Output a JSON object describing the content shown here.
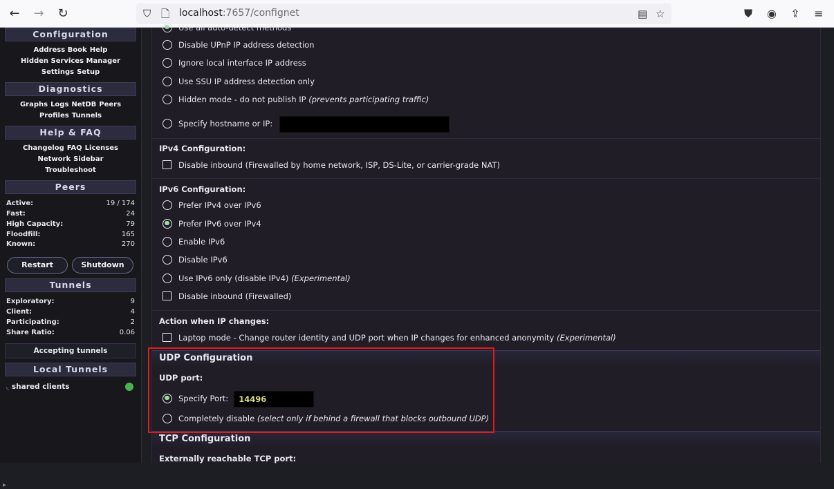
{
  "browser": {
    "url_host": "localhost",
    "url_path": ":7657/confignet",
    "icons": [
      "back-icon",
      "forward-icon",
      "reload-icon",
      "shield-icon",
      "page-icon",
      "reader-icon",
      "bookmark-star-icon",
      "pocket-icon",
      "account-icon",
      "extensions-icon",
      "menu-icon"
    ]
  },
  "sidebar": {
    "configuration": {
      "title": "Configuration",
      "links": [
        "Address Book",
        "Help",
        "Hidden Services Manager",
        "Settings",
        "Setup"
      ]
    },
    "diagnostics": {
      "title": "Diagnostics",
      "links": [
        "Graphs",
        "Logs",
        "NetDB",
        "Peers",
        "Profiles",
        "Tunnels"
      ]
    },
    "help": {
      "title": "Help & FAQ",
      "links": [
        "Changelog",
        "FAQ",
        "Licenses",
        "Network",
        "Sidebar",
        "Troubleshoot"
      ]
    },
    "peers": {
      "title": "Peers",
      "stats": [
        {
          "label": "Active:",
          "value": "19 / 174"
        },
        {
          "label": "Fast:",
          "value": "24"
        },
        {
          "label": "High Capacity:",
          "value": "79"
        },
        {
          "label": "Floodfill:",
          "value": "165"
        },
        {
          "label": "Known:",
          "value": "270"
        }
      ]
    },
    "restart_label": "Restart",
    "shutdown_label": "Shutdown",
    "tunnels": {
      "title": "Tunnels",
      "stats": [
        {
          "label": "Exploratory:",
          "value": "9"
        },
        {
          "label": "Client:",
          "value": "4"
        },
        {
          "label": "Participating:",
          "value": "2"
        },
        {
          "label": "Share Ratio:",
          "value": "0.06"
        }
      ]
    },
    "accepting_label": "Accepting tunnels",
    "local_tunnels": {
      "title": "Local Tunnels",
      "item": "shared clients",
      "status_color": "#4caf50"
    }
  },
  "main": {
    "top_cut_option": "Use all auto-detect methods",
    "ip_options": [
      {
        "label": "Disable UPnP IP address detection",
        "note": ""
      },
      {
        "label": "Ignore local interface IP address",
        "note": ""
      },
      {
        "label": "Use SSU IP address detection only",
        "note": ""
      },
      {
        "label": "Hidden mode - do not publish IP ",
        "note": "(prevents participating traffic)"
      },
      {
        "label": "Specify hostname or IP:",
        "note": ""
      }
    ],
    "ipv4": {
      "title": "IPv4 Configuration:",
      "checkbox": "Disable inbound (Firewalled by home network, ISP, DS-Lite, or carrier-grade NAT)"
    },
    "ipv6": {
      "title": "IPv6 Configuration:",
      "options": [
        {
          "label": "Prefer IPv4 over IPv6",
          "note": "",
          "selected": false
        },
        {
          "label": "Prefer IPv6 over IPv4",
          "note": "",
          "selected": true
        },
        {
          "label": "Enable IPv6",
          "note": "",
          "selected": false
        },
        {
          "label": "Disable IPv6",
          "note": "",
          "selected": false
        },
        {
          "label": "Use IPv6 only (disable IPv4) ",
          "note": "(Experimental)",
          "selected": false
        }
      ],
      "checkbox": "Disable inbound (Firewalled)"
    },
    "ip_change": {
      "title": "Action when IP changes:",
      "checkbox": "Laptop mode - Change router identity and UDP port when IP changes for enhanced anonymity ",
      "note": "(Experimental)"
    },
    "udp": {
      "title": "UDP Configuration",
      "port_label": "UDP port:",
      "specify_label": "Specify Port:",
      "port_value": "14496",
      "disable_label": "Completely disable ",
      "disable_note": "(select only if behind a firewall that blocks outbound UDP)"
    },
    "tcp": {
      "title": "TCP Configuration",
      "port_label": "Externally reachable TCP port:"
    },
    "highlight_color": "#e21b1b"
  }
}
